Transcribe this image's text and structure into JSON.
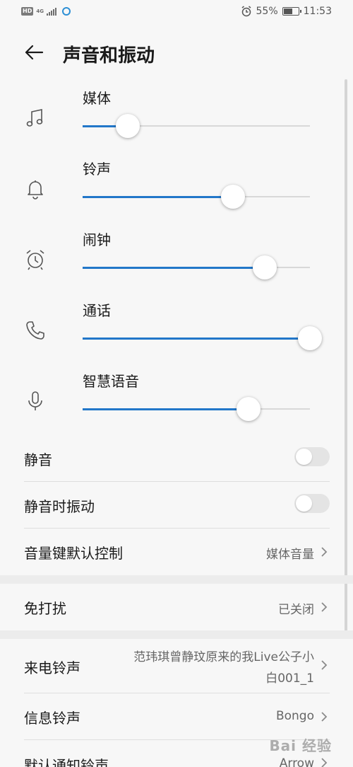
{
  "status_bar": {
    "hd_badge": "HD",
    "network": "4G",
    "battery_percent": "55%",
    "time": "11:53"
  },
  "header": {
    "title": "声音和振动"
  },
  "volume_sliders": [
    {
      "label": "媒体",
      "icon": "music-note-icon",
      "level": 0.2
    },
    {
      "label": "铃声",
      "icon": "bell-icon",
      "level": 0.66
    },
    {
      "label": "闹钟",
      "icon": "alarm-clock-icon",
      "level": 0.8
    },
    {
      "label": "通话",
      "icon": "phone-icon",
      "level": 1.0
    },
    {
      "label": "智慧语音",
      "icon": "microphone-icon",
      "level": 0.73
    }
  ],
  "settings": {
    "mute_label": "静音",
    "mute_on": false,
    "vibrate_on_mute_label": "静音时振动",
    "vibrate_on_mute_on": false,
    "volume_key_label": "音量键默认控制",
    "volume_key_value": "媒体音量",
    "dnd_label": "免打扰",
    "dnd_value": "已关闭",
    "ringtone_label": "来电铃声",
    "ringtone_value_line1": "范玮琪曾静玟原来的我Live公子小",
    "ringtone_value_line2": "白001_1",
    "message_tone_label": "信息铃声",
    "message_tone_value": "Bongo",
    "notification_tone_label": "默认通知铃声",
    "notification_tone_value": "Arrow"
  },
  "watermark": "Bai 经验",
  "colors": {
    "accent": "#2277c9",
    "background": "#f7f7f7",
    "track": "#d8d8d8",
    "toggle_off": "#e4e4e4"
  }
}
